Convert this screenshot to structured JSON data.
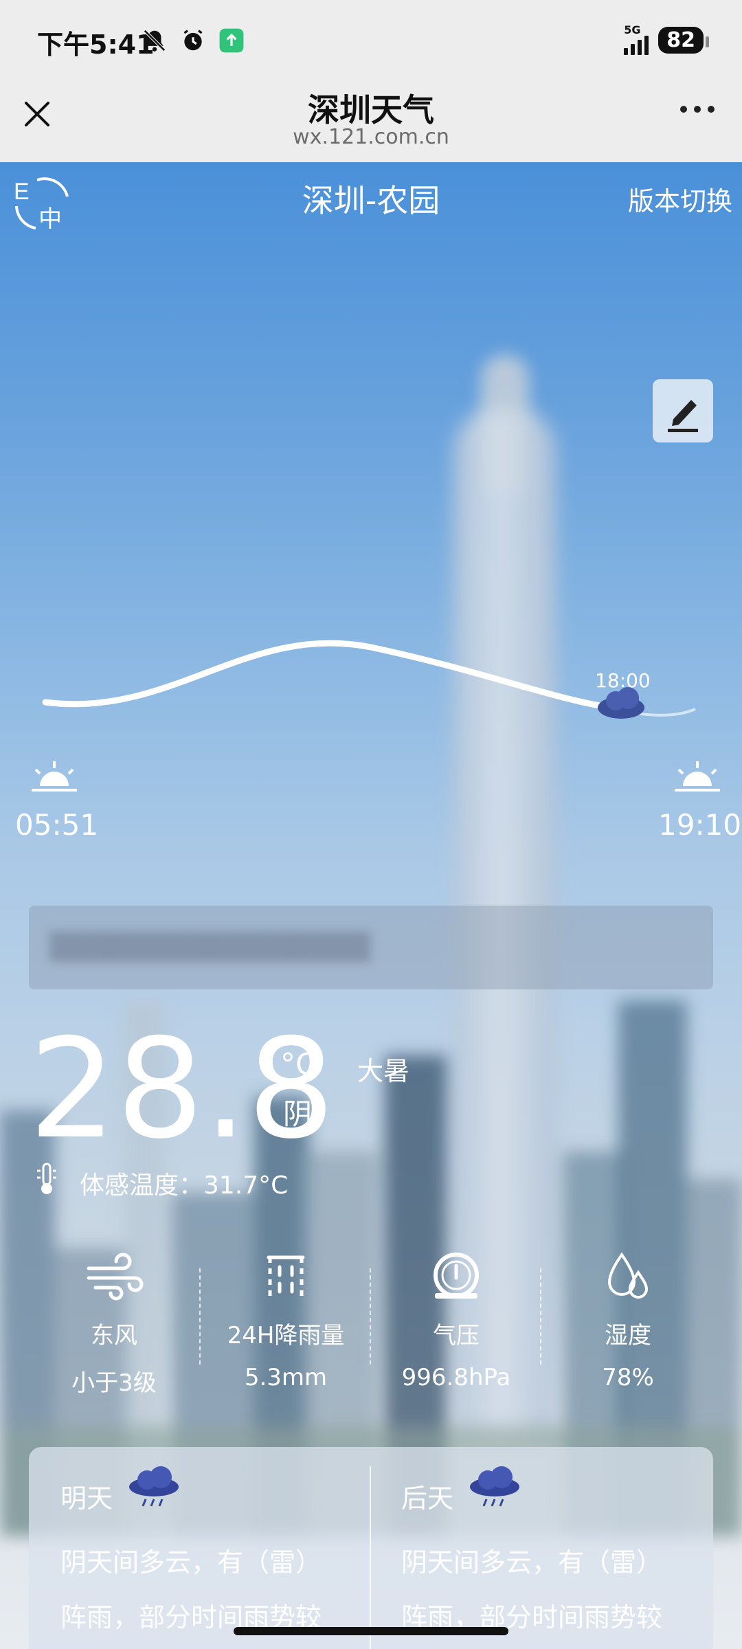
{
  "status_bar": {
    "time": "下午5:41",
    "network": "5G",
    "battery": "82"
  },
  "title_bar": {
    "title": "深圳天气",
    "url": "wx.121.com.cn"
  },
  "header": {
    "location": "深圳-农园",
    "version_switch": "版本切换",
    "lang_icon_letters": [
      "E",
      "中"
    ]
  },
  "sun": {
    "current_time_label": "18:00",
    "sunrise": "05:51",
    "sunset": "19:10"
  },
  "current": {
    "temperature": "28.8",
    "unit": "°C",
    "condition": "阴",
    "solar_term": "大暑",
    "feels_like": "体感温度：31.7°C"
  },
  "metrics": [
    {
      "label": "东风",
      "value": "小于3级",
      "icon": "wind-icon"
    },
    {
      "label": "24H降雨量",
      "value": "5.3mm",
      "icon": "rain-gauge-icon"
    },
    {
      "label": "气压",
      "value": "996.8hPa",
      "icon": "pressure-gauge-icon"
    },
    {
      "label": "湿度",
      "value": "78%",
      "icon": "humidity-icon"
    }
  ],
  "forecast": [
    {
      "day": "明天",
      "line1": "阴天间多云，有（雷）",
      "line2": "阵雨，部分时间雨势较",
      "icon": "thunder-rain-cloud-icon"
    },
    {
      "day": "后天",
      "line1": "阴天间多云，有（雷）",
      "line2": "阵雨，部分时间雨势较",
      "icon": "thunder-rain-cloud-icon"
    }
  ],
  "colors": {
    "sky_top": "#4a90d9",
    "sky_bottom": "#e8ecf1",
    "text_on_sky": "#ffffff",
    "chrome_bg": "#ededed"
  }
}
